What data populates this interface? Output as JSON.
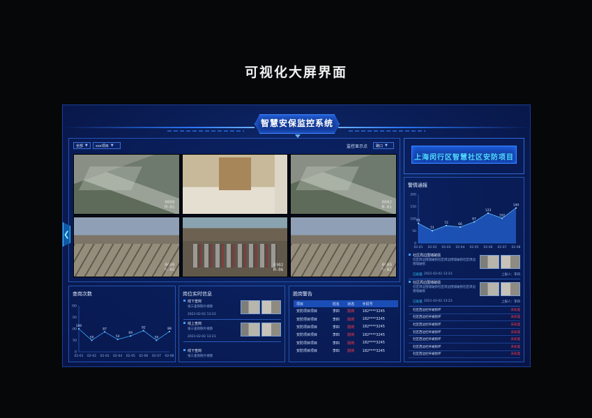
{
  "page_heading": "可视化大屏界面",
  "system_title": "智慧安保监控系统",
  "video": {
    "filter_all": "全部",
    "filter_project": "xxx项目",
    "monitor_label": "监控显示点",
    "monitor_value": "路口",
    "cameras": [
      {
        "ts1": "0009",
        "ts2": "M-01"
      },
      {
        "ts1": "0002",
        "ts2": "M-05"
      },
      {
        "ts1": "0002",
        "ts2": "M-01"
      },
      {
        "ts1": "0009",
        "ts2": "M-05"
      },
      {
        "ts1": "0002",
        "ts2": "M-06"
      },
      {
        "ts1": "0009",
        "ts2": "M-02"
      }
    ]
  },
  "project_title": "上海闵行区智慧社区安防项目",
  "alarm": {
    "title": "警情通报",
    "items": [
      {
        "title": "社区周边围墙破损",
        "desc": "社区周边围墙破损社区周边围墙破损社区周边围墙破损",
        "status": "已处理",
        "time": "2021-02-02 13:23",
        "uploader": "上报人：李四"
      },
      {
        "title": "社区周边围墙破损",
        "desc": "社区周边围墙破损社区周边围墙破损社区周边围墙破损",
        "status": "已处理",
        "time": "2021-02-02 13:23",
        "uploader": "上报人：李四"
      }
    ],
    "pending": [
      {
        "name": "社区西边栏杆被损坏",
        "status": "未处理"
      },
      {
        "name": "社区西边栏杆被损坏",
        "status": "未处理"
      },
      {
        "name": "社区西边栏杆被损坏",
        "status": "未处理"
      },
      {
        "name": "社区西边栏杆被损坏",
        "status": "未处理"
      },
      {
        "name": "社区西边栏杆被损坏",
        "status": "未处理"
      },
      {
        "name": "社区西边栏杆被损坏",
        "status": "未处理"
      },
      {
        "name": "社区西边栏杆被损坏",
        "status": "未处理"
      }
    ]
  },
  "patrol": {
    "title": "查岗次数"
  },
  "post": {
    "title": "岗位实时信息",
    "items": [
      {
        "title": "线下查岗",
        "desc": "张三查岗照片视频",
        "time": "2021-02-02 13:23"
      },
      {
        "title": "线上查岗",
        "desc": "张三查岗照片视频",
        "time": "2021-02-02 13:23"
      },
      {
        "title": "线下查岗",
        "desc": "张三查岗照片视频",
        "time": ""
      }
    ]
  },
  "offduty": {
    "title": "脱岗警告",
    "headers": [
      "项目",
      "姓名",
      "状态",
      "手机号"
    ],
    "rows": [
      [
        "安防项目项目",
        "李四",
        "脱岗",
        "182****3245"
      ],
      [
        "安防项目项目",
        "李四",
        "脱岗",
        "182****3245"
      ],
      [
        "安防项目项目",
        "李四",
        "脱岗",
        "182****3245"
      ],
      [
        "安防项目项目",
        "李四",
        "脱岗",
        "182****3245"
      ],
      [
        "安防项目项目",
        "李四",
        "脱岗",
        "182****3245"
      ],
      [
        "安防项目项目",
        "李四",
        "脱岗",
        "182****3245"
      ]
    ]
  },
  "colors": {
    "accent": "#2c7bff",
    "title_cyan": "#4fd8ff",
    "alert_red": "#ff3b4a",
    "panel_border": "#2455b8"
  },
  "chart_data": [
    {
      "type": "line",
      "title": "查岗次数",
      "categories": [
        "02-01",
        "02-02",
        "02-03",
        "02-04",
        "02-05",
        "02-06",
        "02-07",
        "02-08"
      ],
      "values": [
        100,
        50,
        87,
        54,
        69,
        92,
        50,
        88
      ],
      "ylim": [
        0,
        200
      ],
      "yticks": [
        0,
        50,
        100,
        150,
        200
      ],
      "grid": false
    },
    {
      "type": "area",
      "title": "警情通报",
      "categories": [
        "02-01",
        "02-02",
        "02-03",
        "02-04",
        "02-05",
        "02-06",
        "02-07",
        "02-08"
      ],
      "values": [
        81,
        51,
        72,
        66,
        87,
        123,
        102,
        144
      ],
      "ylim": [
        0,
        200
      ],
      "yticks": [
        0,
        50,
        100,
        150,
        200
      ],
      "grid": false
    }
  ]
}
